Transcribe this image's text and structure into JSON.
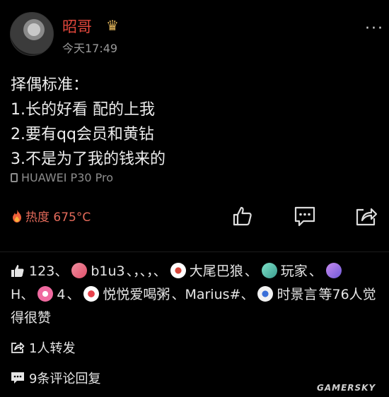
{
  "header": {
    "username": "昭哥",
    "timestamp": "今天17:49"
  },
  "post": {
    "lines": [
      "择偶标准：",
      "1.长的好看 配的上我",
      "2.要有qq会员和黄钻",
      "3.不是为了我的钱来的"
    ],
    "device": "HUAWEI P30 Pro",
    "heat": "热度 675°C"
  },
  "likes": {
    "count": "123",
    "names": [
      "b1u3",
      "，",
      "，",
      "大尾巴狼",
      "玩家",
      "H",
      "4",
      "悦悦爱喝粥",
      "Marius#",
      "时景言"
    ],
    "suffix": "等76人觉得很赞"
  },
  "shares": "1人转发",
  "comments": "9条评论回复",
  "watermark": "GAMERSKY",
  "colors": {
    "username": "#e2473c",
    "heat": "#e36a5a",
    "background": "#000000"
  }
}
